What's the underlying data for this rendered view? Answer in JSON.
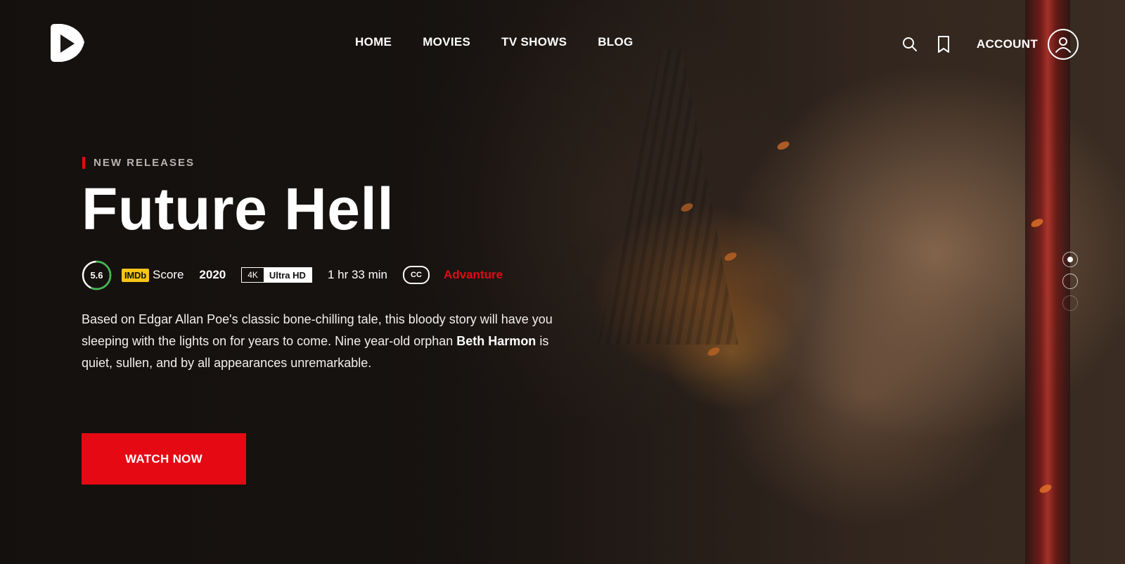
{
  "brand": {
    "logo_icon": "play-logo-icon"
  },
  "nav": {
    "items": [
      {
        "label": "HOME"
      },
      {
        "label": "MOVIES"
      },
      {
        "label": "TV SHOWS"
      },
      {
        "label": "BLOG"
      }
    ]
  },
  "header_tools": {
    "search_icon": "search-icon",
    "bookmark_icon": "bookmark-icon",
    "account_label": "ACCOUNT",
    "avatar_icon": "user-icon"
  },
  "hero": {
    "eyebrow": "NEW RELEASES",
    "title": "Future Hell",
    "rating": "5.6",
    "rating_fraction": 0.56,
    "imdb_badge": "IMDb",
    "score_label": "Score",
    "year": "2020",
    "quality_res": "4K",
    "quality_label": "Ultra HD",
    "duration": "1 hr 33 min",
    "cc_label": "CC",
    "genre": "Advanture",
    "description_parts": {
      "p1": "Based on Edgar Allan Poe's classic bone-chilling tale, this bloody story will have you sleeping with the lights on for years to come. Nine year-old orphan ",
      "bold": "Beth Harmon",
      "p2": " is quiet, sullen, and by all appearances unremarkable."
    },
    "cta_label": "WATCH NOW"
  },
  "slider": {
    "count": 3,
    "active_index": 0
  },
  "colors": {
    "accent": "#e50914",
    "imdb_yellow": "#f5c518",
    "rating_ring": "#3fb950"
  }
}
